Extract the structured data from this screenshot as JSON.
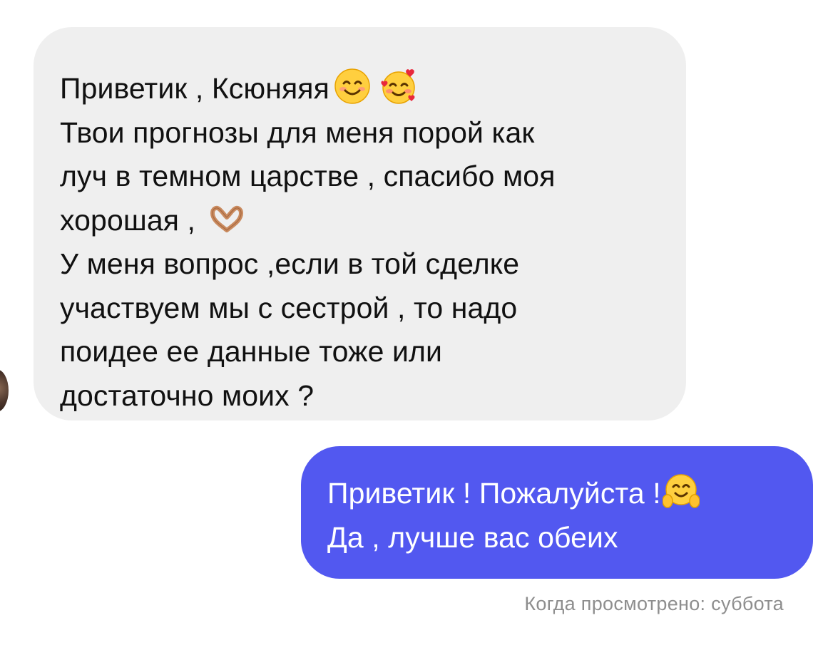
{
  "incoming_message": {
    "line1": "Приветик , Ксюняяя",
    "line2": "Твои прогнозы для меня порой как",
    "line3": "луч в темном царстве , спасибо моя",
    "line4": "хорошая ,",
    "line5": "У меня вопрос ,если в той сделке",
    "line6": "участвуем мы с сестрой , то надо",
    "line7": "поидее ее данные тоже или",
    "line8": "достаточно моих ?",
    "emojis": [
      "smiling-face-icon",
      "smiling-face-with-hearts-icon",
      "heart-hands-icon"
    ]
  },
  "outgoing_message": {
    "line1": "Приветик  ! Пожалуйста !",
    "line2": "Да , лучше вас обеих",
    "emojis": [
      "hugging-face-icon"
    ]
  },
  "status": {
    "seen_text": "Когда просмотрено: суббота"
  },
  "colors": {
    "incoming_bubble": "#efefef",
    "outgoing_bubble": "#5258f0",
    "status_text": "#8e8e8e"
  }
}
